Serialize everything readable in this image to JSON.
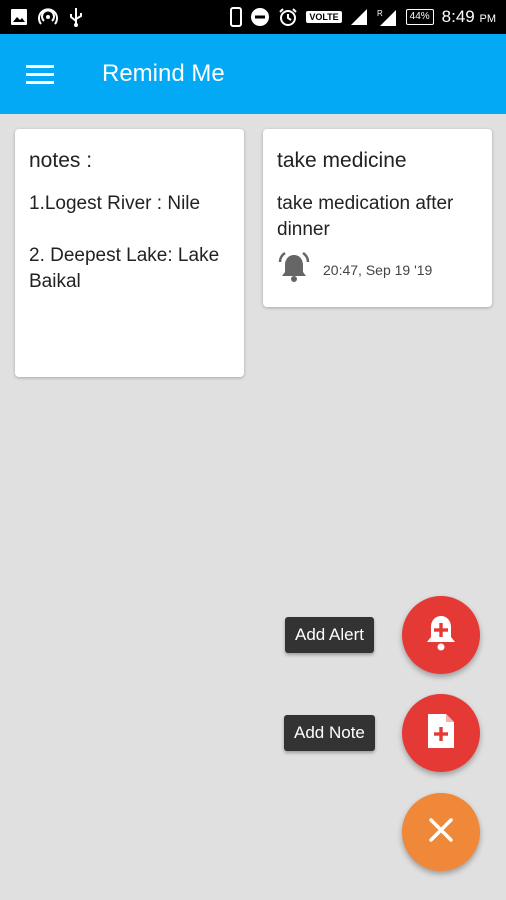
{
  "status_bar": {
    "volte": "VOLTE",
    "battery": "44%",
    "time": "8:49",
    "ampm": "PM",
    "icons": [
      "image-icon",
      "hotspot-icon",
      "usb-icon",
      "phone-icon",
      "dnd-icon",
      "alarm-icon",
      "signal-icon",
      "signal-roaming-icon",
      "battery-icon"
    ]
  },
  "app_bar": {
    "title": "Remind Me",
    "menu_icon": "hamburger-menu-icon",
    "color": "#03a9f4"
  },
  "notes": [
    {
      "title": "notes :",
      "body": "1.Logest River : Nile\n\n2. Deepest Lake: Lake Baikal"
    },
    {
      "title": "take medicine",
      "body": "take medication after dinner",
      "alarm_icon": "alarm-bell-icon",
      "alarm_time": "20:47, Sep 19 '19"
    }
  ],
  "fab_menu": {
    "add_alert": {
      "label": "Add Alert",
      "icon": "bell-plus-icon"
    },
    "add_note": {
      "label": "Add Note",
      "icon": "file-plus-icon"
    },
    "close": {
      "icon": "close-icon"
    },
    "colors": {
      "action": "#e53935",
      "main": "#f0883a"
    }
  }
}
